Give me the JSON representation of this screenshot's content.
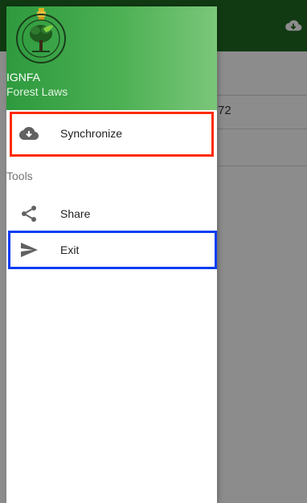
{
  "background": {
    "partial_text": "72"
  },
  "drawer": {
    "header": {
      "title": "IGNFA",
      "subtitle": "Forest Laws"
    },
    "items": [
      {
        "label": "Synchronize",
        "icon": "cloud-download-icon"
      },
      {
        "label": "Share",
        "icon": "share-icon"
      },
      {
        "label": "Exit",
        "icon": "send-icon"
      }
    ],
    "section_tools": "Tools"
  },
  "colors": {
    "app_bar": "#1f6b24",
    "header_gradient_start": "#2e9a3e",
    "header_gradient_end": "#7bc67a",
    "highlight_red": "#ff2a00",
    "highlight_blue": "#0a3cf5"
  }
}
